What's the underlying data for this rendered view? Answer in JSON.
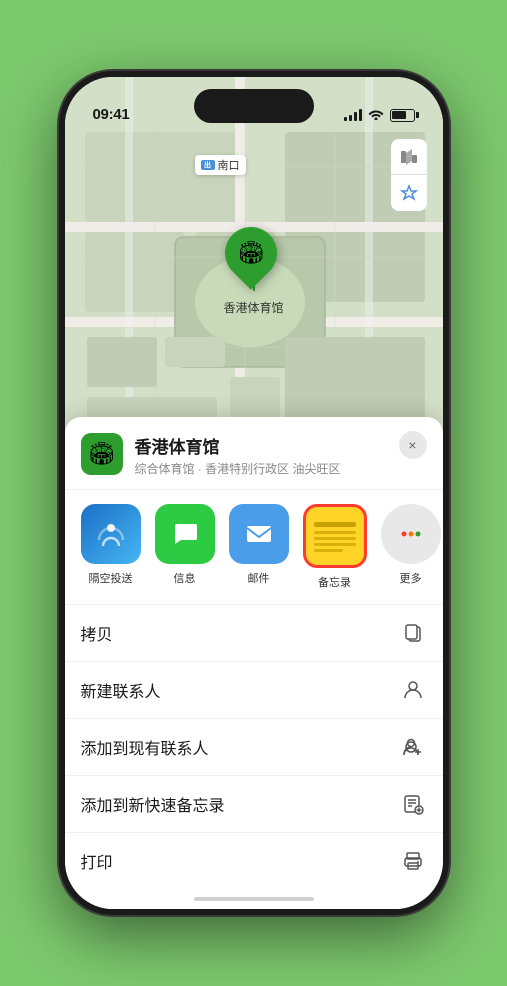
{
  "status": {
    "time": "09:41",
    "location_arrow": "▶"
  },
  "map": {
    "label_text": "南口",
    "label_prefix": "出"
  },
  "pin": {
    "label": "香港体育馆",
    "emoji": "🏟"
  },
  "venue": {
    "name": "香港体育馆",
    "description": "综合体育馆 · 香港特别行政区 油尖旺区",
    "icon_emoji": "🏟"
  },
  "share_actions": [
    {
      "id": "airdrop",
      "label": "隔空投送",
      "type": "airdrop"
    },
    {
      "id": "messages",
      "label": "信息",
      "type": "messages"
    },
    {
      "id": "mail",
      "label": "邮件",
      "type": "mail"
    },
    {
      "id": "notes",
      "label": "备忘录",
      "type": "notes"
    },
    {
      "id": "more",
      "label": "更多",
      "type": "more"
    }
  ],
  "menu_items": [
    {
      "id": "copy",
      "label": "拷贝",
      "icon": "copy"
    },
    {
      "id": "new-contact",
      "label": "新建联系人",
      "icon": "person"
    },
    {
      "id": "add-to-contact",
      "label": "添加到现有联系人",
      "icon": "person-add"
    },
    {
      "id": "add-to-notes",
      "label": "添加到新快速备忘录",
      "icon": "notes-quick"
    },
    {
      "id": "print",
      "label": "打印",
      "icon": "printer"
    }
  ],
  "close_label": "×",
  "colors": {
    "green": "#2d9e2d",
    "notes_yellow": "#ffd426",
    "notes_border": "#ff3b30"
  }
}
